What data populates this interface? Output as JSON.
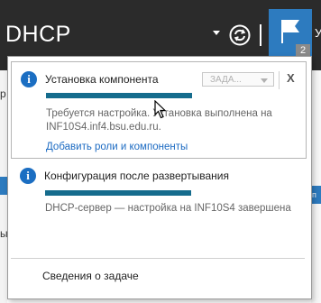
{
  "header": {
    "title": "DHCP",
    "user_initial": "У",
    "notifications_count": "2"
  },
  "background": {
    "left_text_1": "р",
    "left_text_2": "ы",
    "right_button_char": "п"
  },
  "notifications": [
    {
      "title": "Установка компонента",
      "progress": 1.0,
      "tasks_label": "ЗАДА...",
      "close_label": "X",
      "description": "Требуется настройка. Установка выполнена на INF10S4.inf4.bsu.edu.ru.",
      "link": "Добавить роли и компоненты"
    },
    {
      "title": "Конфигурация после развертывания",
      "progress": 1.0,
      "description": "DHCP-сервер — настройка на INF10S4 завершена"
    }
  ],
  "footer": {
    "task_details": "Сведения о задаче"
  },
  "colors": {
    "topbar": "#2b2b2b",
    "flag_bg": "#2d7bbf",
    "progress": "#156c8d",
    "link": "#1b6ac2",
    "info_icon": "#1b6ec2"
  }
}
